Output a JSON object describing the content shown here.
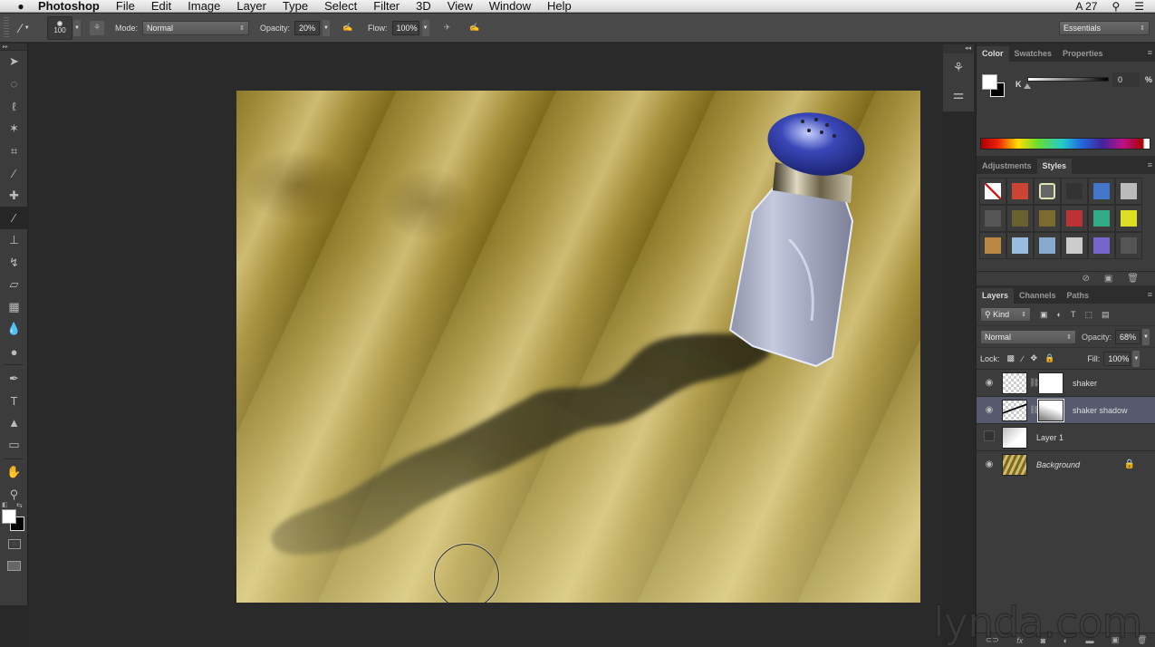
{
  "menubar": {
    "app_name": "Photoshop",
    "items": [
      "File",
      "Edit",
      "Image",
      "Layer",
      "Type",
      "Select",
      "Filter",
      "3D",
      "View",
      "Window",
      "Help"
    ],
    "status_right": "27"
  },
  "options": {
    "brush_size": "100",
    "mode_label": "Mode:",
    "mode_value": "Normal",
    "opacity_label": "Opacity:",
    "opacity_value": "20%",
    "flow_label": "Flow:",
    "flow_value": "100%",
    "workspace": "Essentials"
  },
  "tools": [
    {
      "name": "move-tool",
      "glyph": "➤"
    },
    {
      "name": "marquee-tool",
      "glyph": "◌"
    },
    {
      "name": "lasso-tool",
      "glyph": "ℓ"
    },
    {
      "name": "magic-wand-tool",
      "glyph": "✶"
    },
    {
      "name": "crop-tool",
      "glyph": "⌗"
    },
    {
      "name": "eyedropper-tool",
      "glyph": "⁄"
    },
    {
      "name": "healing-brush-tool",
      "glyph": "✚"
    },
    {
      "name": "brush-tool",
      "glyph": "∕",
      "active": true
    },
    {
      "name": "clone-stamp-tool",
      "glyph": "⊥"
    },
    {
      "name": "history-brush-tool",
      "glyph": "↯"
    },
    {
      "name": "eraser-tool",
      "glyph": "▱"
    },
    {
      "name": "gradient-tool",
      "glyph": "▦"
    },
    {
      "name": "blur-tool",
      "glyph": "💧"
    },
    {
      "name": "dodge-tool",
      "glyph": "●"
    },
    {
      "name": "pen-tool",
      "glyph": "✒"
    },
    {
      "name": "type-tool",
      "glyph": "T"
    },
    {
      "name": "path-selection-tool",
      "glyph": "▲"
    },
    {
      "name": "shape-tool",
      "glyph": "▭"
    },
    {
      "name": "hand-tool",
      "glyph": "✋"
    },
    {
      "name": "zoom-tool",
      "glyph": "⚲"
    }
  ],
  "color_panel": {
    "tabs": [
      "Color",
      "Swatches",
      "Properties"
    ],
    "active_tab": "Color",
    "channel_label": "K",
    "channel_value": "0",
    "unit": "%"
  },
  "styles_panel": {
    "tabs": [
      "Adjustments",
      "Styles"
    ],
    "active_tab": "Styles",
    "swatches": [
      "#fff",
      "#c43",
      "#666",
      "#333",
      "#47c",
      "#bbb",
      "#555",
      "#6a5f2e",
      "#7b6a30",
      "#b33",
      "#3a8",
      "#dd2",
      "#b84",
      "#9bd",
      "#8ac",
      "#ccc",
      "#76c",
      "#555"
    ]
  },
  "layers_panel": {
    "tabs": [
      "Layers",
      "Channels",
      "Paths"
    ],
    "active_tab": "Layers",
    "filter_label": "Kind",
    "blend_mode": "Normal",
    "opacity_label": "Opacity:",
    "opacity_value": "68%",
    "lock_label": "Lock:",
    "fill_label": "Fill:",
    "fill_value": "100%",
    "layers": [
      {
        "name": "shaker",
        "visible": true,
        "selected": false,
        "has_mask": true
      },
      {
        "name": "shaker shadow",
        "visible": true,
        "selected": true,
        "has_mask": true
      },
      {
        "name": "Layer 1",
        "visible": false,
        "selected": false,
        "has_mask": false
      },
      {
        "name": "Background",
        "visible": true,
        "selected": false,
        "has_mask": false,
        "locked": true
      }
    ]
  },
  "watermark": "lynda.com"
}
